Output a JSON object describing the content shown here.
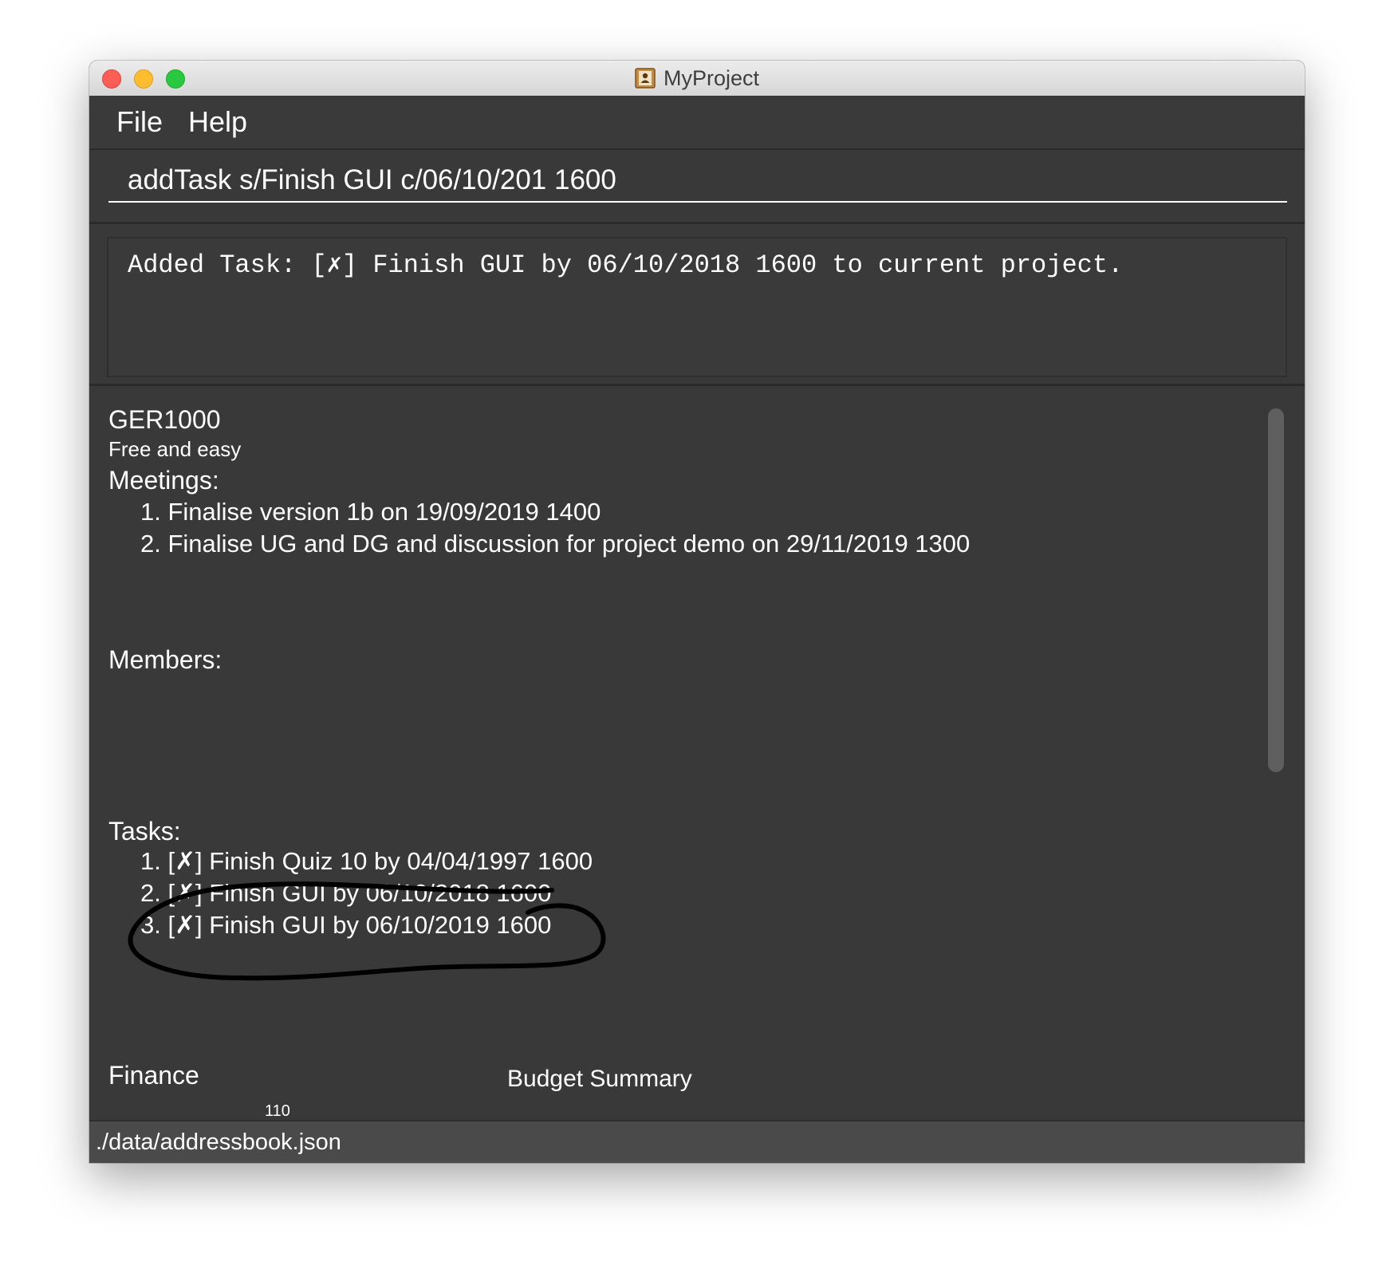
{
  "window": {
    "title": "MyProject"
  },
  "menu": {
    "items": [
      {
        "label": "File"
      },
      {
        "label": "Help"
      }
    ]
  },
  "command_box": {
    "value": "addTask s/Finish GUI c/06/10/201 1600"
  },
  "result_display": {
    "text": "Added Task: [✗] Finish GUI by 06/10/2018 1600 to current project."
  },
  "project": {
    "name": "GER1000",
    "description": "Free and easy",
    "meetings_heading": "Meetings:",
    "meetings": [
      "1. Finalise version 1b on 19/09/2019 1400",
      "2. Finalise UG and DG and discussion for project demo on 29/11/2019 1300"
    ],
    "members_heading": "Members:",
    "tasks_heading": "Tasks:",
    "tasks": [
      "1. [✗] Finish Quiz 10 by 04/04/1997 1600",
      "2. [✗] Finish GUI by 06/10/2018 1600",
      "3. [✗] Finish GUI by 06/10/2019 1600"
    ],
    "finance_heading": "Finance",
    "budget_summary_title": "Budget Summary",
    "budget_axis_tick": "110"
  },
  "status_bar": {
    "path": "./data/addressbook.json"
  },
  "colors": {
    "background": "#393939",
    "text": "#ffffff",
    "status_bar": "#4a4a4a",
    "close": "#fd5f57",
    "minimize": "#febd2e",
    "maximize": "#28c940"
  },
  "icons": {
    "app": "address-book-icon",
    "annotation": "hand-drawn-circle"
  }
}
